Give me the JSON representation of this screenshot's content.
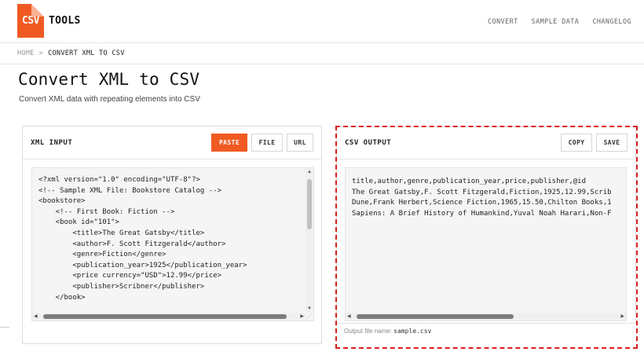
{
  "logo": {
    "box": "CSV",
    "text": "TOOLS",
    "color": "#f05a22"
  },
  "nav": {
    "convert": "CONVERT",
    "sample_data": "SAMPLE DATA",
    "changelog": "CHANGELOG"
  },
  "breadcrumb": {
    "home": "HOME",
    "sep": ">",
    "current": "CONVERT XML TO CSV"
  },
  "page": {
    "title": "Convert XML to CSV",
    "subtitle": "Convert XML data with repeating elements into CSV"
  },
  "xml_panel": {
    "title": "XML INPUT",
    "buttons": {
      "paste": "PASTE",
      "file": "FILE",
      "url": "URL"
    },
    "lines": [
      "<?xml version=\"1.0\" encoding=\"UTF-8\"?>",
      "<!-- Sample XML File: Bookstore Catalog -->",
      "<bookstore>",
      "    <!-- First Book: Fiction -->",
      "    <book id=\"101\">",
      "        <title>The Great Gatsby</title>",
      "        <author>F. Scott Fitzgerald</author>",
      "        <genre>Fiction</genre>",
      "        <publication_year>1925</publication_year>",
      "        <price currency=\"USD\">12.99</price>",
      "        <publisher>Scribner</publisher>",
      "    </book>"
    ]
  },
  "csv_panel": {
    "title": "CSV OUTPUT",
    "buttons": {
      "copy": "COPY",
      "save": "SAVE"
    },
    "lines": [
      "title,author,genre,publication_year,price,publisher,@id",
      "The Great Gatsby,F. Scott Fitzgerald,Fiction,1925,12.99,Scrib",
      "Dune,Frank Herbert,Science Fiction,1965,15.50,Chilton Books,1",
      "Sapiens: A Brief History of Humankind,Yuval Noah Harari,Non-F"
    ],
    "output_label": "Output file name:",
    "output_filename": "sample.csv"
  },
  "colors": {
    "accent": "#f05a22",
    "highlight": "#d91e1e"
  }
}
